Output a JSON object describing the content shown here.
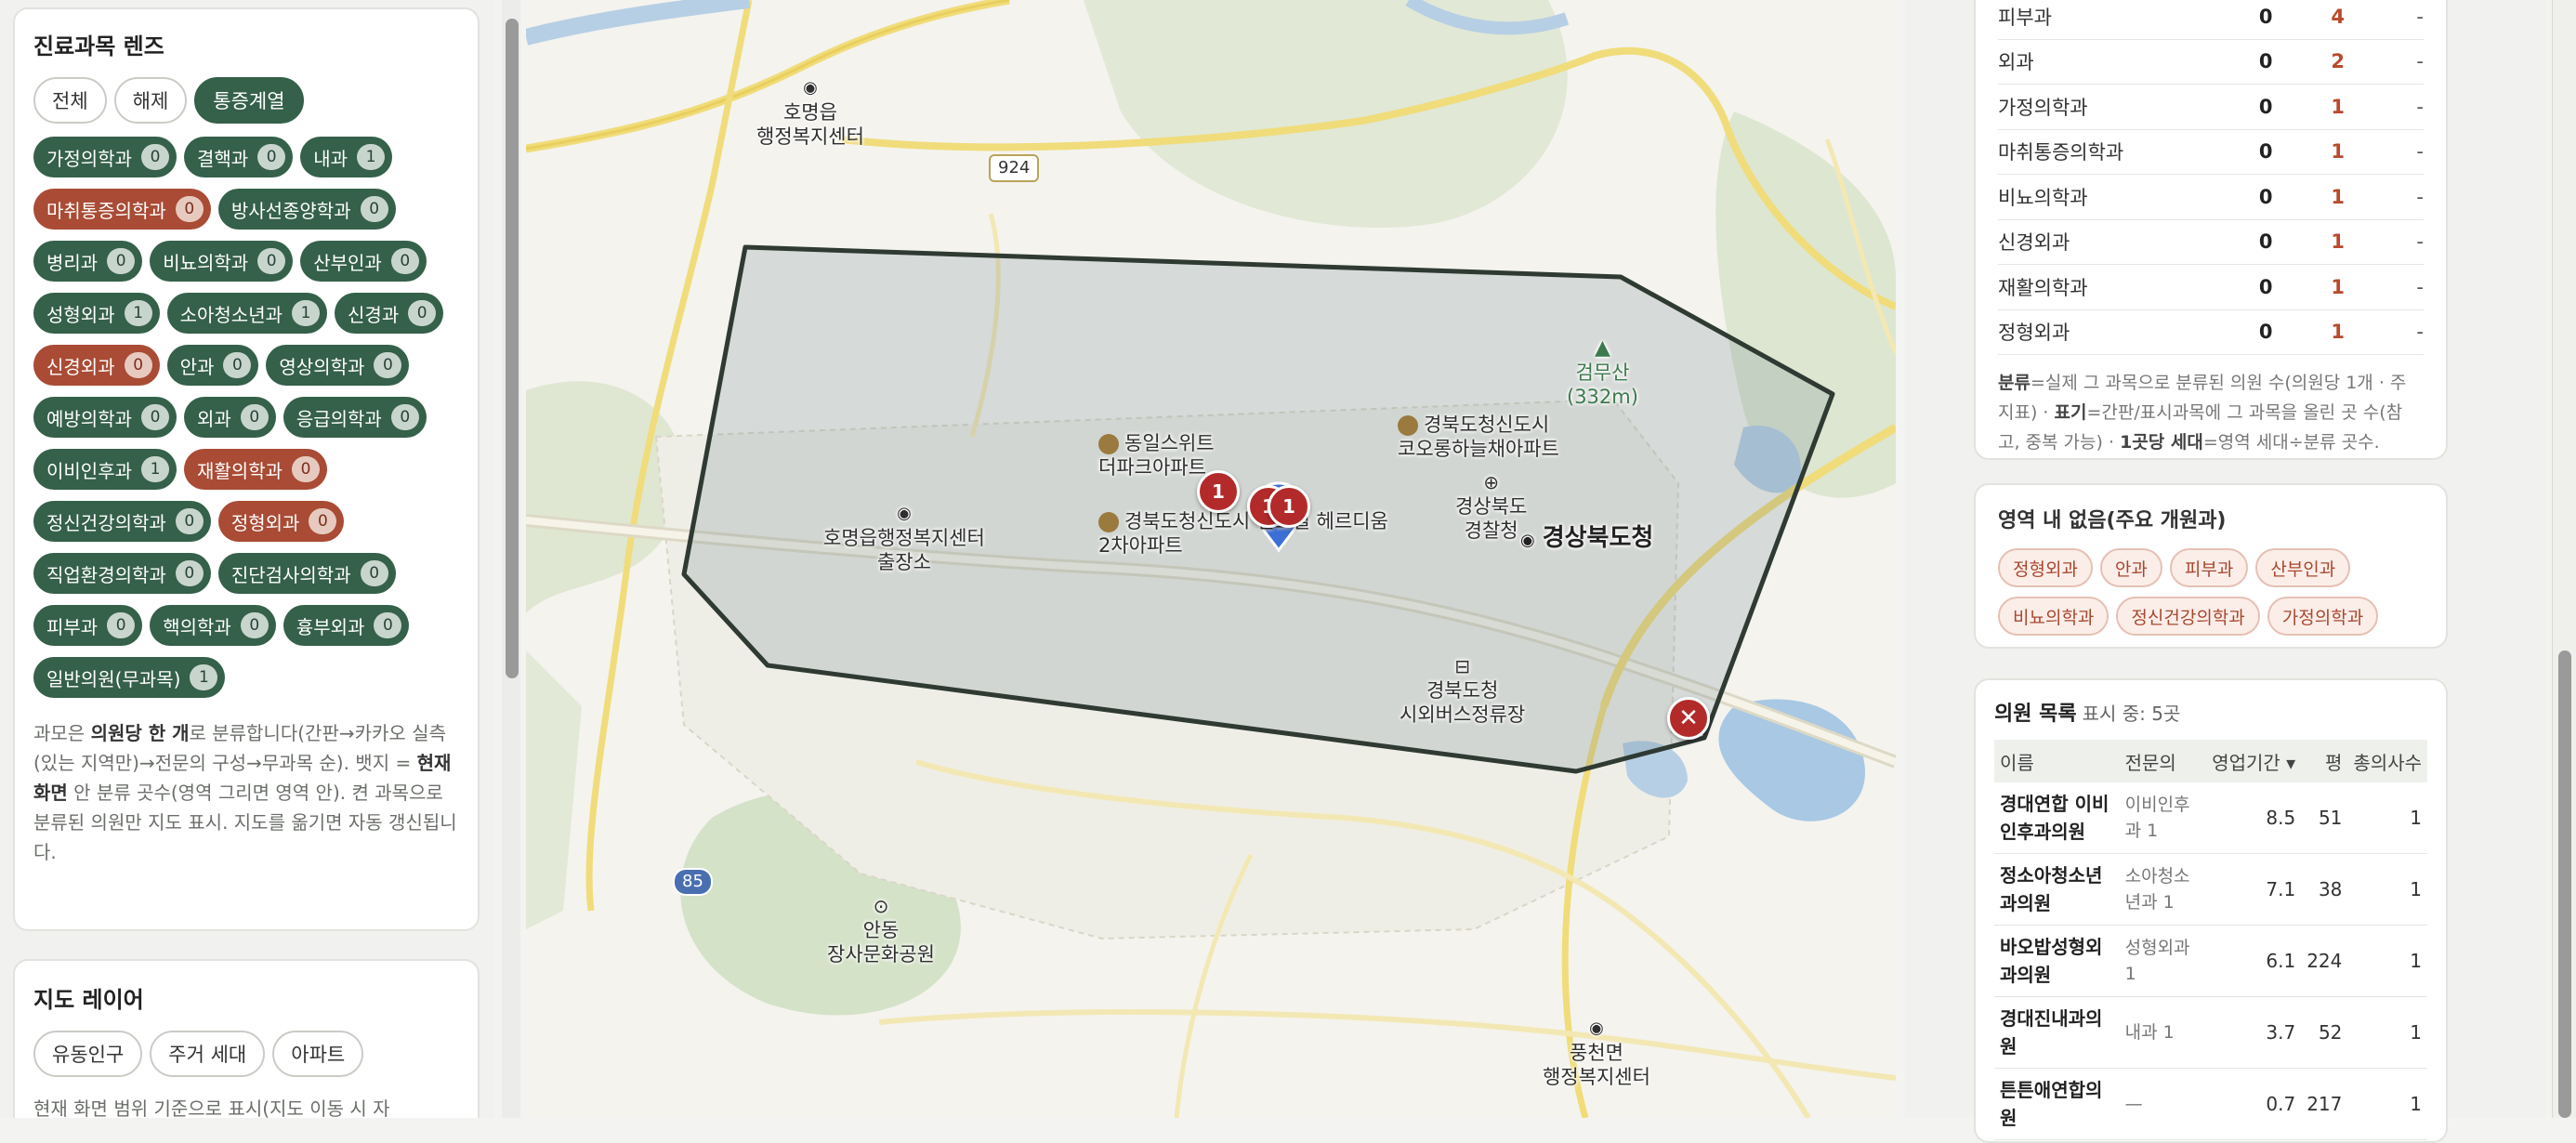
{
  "lens": {
    "title": "진료과목 렌즈",
    "controls": [
      "전체",
      "해제",
      "통증계열"
    ],
    "chips": [
      {
        "label": "가정의학과",
        "count": "0",
        "highlight": false
      },
      {
        "label": "결핵과",
        "count": "0",
        "highlight": false
      },
      {
        "label": "내과",
        "count": "1",
        "highlight": false
      },
      {
        "label": "마취통증의학과",
        "count": "0",
        "highlight": true
      },
      {
        "label": "방사선종양학과",
        "count": "0",
        "highlight": false
      },
      {
        "label": "병리과",
        "count": "0",
        "highlight": false
      },
      {
        "label": "비뇨의학과",
        "count": "0",
        "highlight": false
      },
      {
        "label": "산부인과",
        "count": "0",
        "highlight": false
      },
      {
        "label": "성형외과",
        "count": "1",
        "highlight": false
      },
      {
        "label": "소아청소년과",
        "count": "1",
        "highlight": false
      },
      {
        "label": "신경과",
        "count": "0",
        "highlight": false
      },
      {
        "label": "신경외과",
        "count": "0",
        "highlight": true
      },
      {
        "label": "안과",
        "count": "0",
        "highlight": false
      },
      {
        "label": "영상의학과",
        "count": "0",
        "highlight": false
      },
      {
        "label": "예방의학과",
        "count": "0",
        "highlight": false
      },
      {
        "label": "외과",
        "count": "0",
        "highlight": false
      },
      {
        "label": "응급의학과",
        "count": "0",
        "highlight": false
      },
      {
        "label": "이비인후과",
        "count": "1",
        "highlight": false
      },
      {
        "label": "재활의학과",
        "count": "0",
        "highlight": true
      },
      {
        "label": "정신건강의학과",
        "count": "0",
        "highlight": false
      },
      {
        "label": "정형외과",
        "count": "0",
        "highlight": true
      },
      {
        "label": "직업환경의학과",
        "count": "0",
        "highlight": false
      },
      {
        "label": "진단검사의학과",
        "count": "0",
        "highlight": false
      },
      {
        "label": "피부과",
        "count": "0",
        "highlight": false
      },
      {
        "label": "핵의학과",
        "count": "0",
        "highlight": false
      },
      {
        "label": "흉부외과",
        "count": "0",
        "highlight": false
      },
      {
        "label": "일반의원(무과목)",
        "count": "1",
        "highlight": false
      }
    ],
    "note_parts": [
      "과모은 ",
      "의원당 한 개",
      "로 분류합니다(간판→카카오 실측(있는 지역만)→전문의 구성→무과목 순). 뱃지 = ",
      "현재 화면",
      " 안 분류 곳수(영역 그리면 영역 안). 켠 과목으로 분류된 의원만 지도 표시. 지도를 옮기면 자동 갱신됩니다."
    ]
  },
  "layers": {
    "title": "지도 레이어",
    "buttons": [
      "유동인구",
      "주거 세대",
      "아파트"
    ],
    "note": "현재 화면 범위 기준으로 표시(지도 이동 시 자"
  },
  "map": {
    "labels": [
      {
        "name": "label-homyeong-eup",
        "text": "호명읍\n행정복지센터"
      },
      {
        "name": "label-geommusan",
        "text": "검무산\n(332m)"
      },
      {
        "name": "label-dongil-suite",
        "text": "동일스위트\n더파크아파트"
      },
      {
        "name": "label-cheongsin-koaroong",
        "text": "경북도청신도시\n코오롱하늘채아파트"
      },
      {
        "name": "label-homyeong-branch",
        "text": "호명읍행정복지센터\n출장소"
      },
      {
        "name": "label-gyeongbuk-police",
        "text": "경상북도\n경찰청"
      },
      {
        "name": "label-gyeongbuk-province",
        "text": "경상북도청"
      },
      {
        "name": "label-cheongsin-2cha",
        "text": "경북도청신도시 센트럴 헤르디움\n2차아파트"
      },
      {
        "name": "label-bus-terminal",
        "text": "경북도청\n시외버스정류장"
      },
      {
        "name": "label-andong-park",
        "text": "안동\n장사문화공원"
      },
      {
        "name": "label-pungcheon",
        "text": "풍천면\n행정복지센터"
      }
    ],
    "road_shields": [
      "924",
      "85"
    ],
    "markers": [
      "1",
      "1",
      "1"
    ]
  },
  "stats": {
    "rows": [
      {
        "name": "피부과",
        "a": "0",
        "b": "4",
        "c": "-"
      },
      {
        "name": "외과",
        "a": "0",
        "b": "2",
        "c": "-"
      },
      {
        "name": "가정의학과",
        "a": "0",
        "b": "1",
        "c": "-"
      },
      {
        "name": "마취통증의학과",
        "a": "0",
        "b": "1",
        "c": "-"
      },
      {
        "name": "비뇨의학과",
        "a": "0",
        "b": "1",
        "c": "-"
      },
      {
        "name": "신경외과",
        "a": "0",
        "b": "1",
        "c": "-"
      },
      {
        "name": "재활의학과",
        "a": "0",
        "b": "1",
        "c": "-"
      },
      {
        "name": "정형외과",
        "a": "0",
        "b": "1",
        "c": "-"
      }
    ],
    "note_parts": [
      "분류",
      "=실제 그 과목으로 분류된 의원 수(의원당 1개 · 주 지표) · ",
      "표기",
      "=간판/표시과목에 그 과목을 올린 곳 수(참고, 중복 가능) · ",
      "1곳당 세대",
      "=영역 세대÷분류 곳수."
    ]
  },
  "absent": {
    "title": "영역 내 없음(주요 개원과)",
    "tags": [
      "정형외과",
      "안과",
      "피부과",
      "산부인과",
      "비뇨의학과",
      "정신건강의학과",
      "가정의학과"
    ]
  },
  "clinic_list": {
    "title": "의원 목록",
    "subtitle": "표시 중: 5곳",
    "headers": [
      "이름",
      "전문의",
      "영업기간 ▾",
      "평",
      "총의사수"
    ],
    "rows": [
      {
        "name": "경대연합 이비인후과의원",
        "spec": "이비인후과 1",
        "years": "8.5",
        "area": "51",
        "doctors": "1"
      },
      {
        "name": "정소아청소년과의원",
        "spec": "소아청소년과 1",
        "years": "7.1",
        "area": "38",
        "doctors": "1"
      },
      {
        "name": "바오밥성형외과의원",
        "spec": "성형외과 1",
        "years": "6.1",
        "area": "224",
        "doctors": "1"
      },
      {
        "name": "경대진내과의원",
        "spec": "내과 1",
        "years": "3.7",
        "area": "52",
        "doctors": "1"
      },
      {
        "name": "튼튼애연합의원",
        "spec": "—",
        "years": "0.7",
        "area": "217",
        "doctors": "1"
      }
    ]
  }
}
